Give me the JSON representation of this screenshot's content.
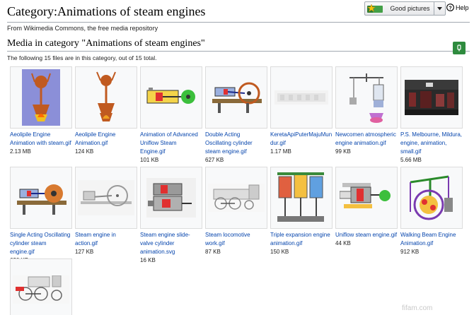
{
  "page": {
    "title": "Category:Animations of steam engines",
    "tagline": "From Wikimedia Commons, the free media repository"
  },
  "header": {
    "good_pictures_label": "Good pictures",
    "help_label": "Help"
  },
  "section": {
    "heading": "Media in category \"Animations of steam engines\"",
    "count_text": "The following 15 files are in this category, out of 15 total."
  },
  "files": [
    {
      "name": "Aeolipile Engine Animation with steam.gif",
      "size": "2.13 MB"
    },
    {
      "name": "Aeolipile Engine Animation.gif",
      "size": "124 KB"
    },
    {
      "name": "Animation of Advanced Uniflow Steam Engine.gif",
      "size": "101 KB"
    },
    {
      "name": "Double Acting Oscillating cylinder steam engine.gif",
      "size": "627 KB"
    },
    {
      "name": "KeretaApiPuterMajuMundur.gif",
      "size": "1.17 MB"
    },
    {
      "name": "Newcomen atmospheric engine animation.gif",
      "size": "99 KB"
    },
    {
      "name": "P.S. Melbourne, Mildura, engine, animation, small.gif",
      "size": "5.66 MB"
    },
    {
      "name": "Single Acting Oscillating cylinder steam engine.gif",
      "size": "630 KB"
    },
    {
      "name": "Steam engine in action.gif",
      "size": "127 KB"
    },
    {
      "name": "Steam engine slide-valve cylinder animation.svg",
      "size": "16 KB"
    },
    {
      "name": "Steam locomotive work.gif",
      "size": "87 KB"
    },
    {
      "name": "Triple expansion engine animation.gif",
      "size": "150 KB"
    },
    {
      "name": "Uniflow steam engine.gif",
      "size": "44 KB"
    },
    {
      "name": "Walking Beam Engine Animation.gif",
      "size": "912 KB"
    },
    {
      "name": "",
      "size": ""
    }
  ],
  "watermark": "fifam.com",
  "colors": {
    "link": "#0645ad",
    "accent_green": "#2e8b3e"
  }
}
